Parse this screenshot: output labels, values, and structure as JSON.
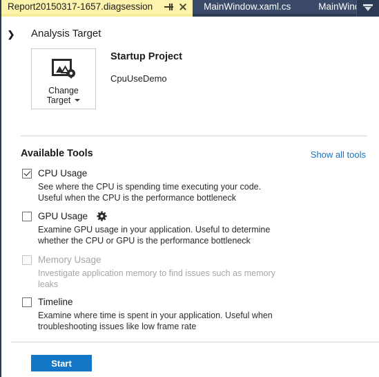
{
  "tabs": {
    "active": {
      "label": "Report20150317-1657.diagsession",
      "pin_icon": "pin-icon",
      "close_icon": "close-icon"
    },
    "inactive": [
      {
        "label": "MainWindow.xaml.cs"
      },
      {
        "label": "MainWindow.xaml"
      }
    ],
    "overflow_icon": "tab-overflow-chevron-icon"
  },
  "analysis": {
    "expander_icon": "chevron-right-icon",
    "section_title": "Analysis Target",
    "change_target": {
      "icon": "image-settings-icon",
      "line1": "Change",
      "line2": "Target",
      "caret_icon": "chevron-down-icon"
    },
    "startup_heading": "Startup Project",
    "startup_value": "CpuUseDemo"
  },
  "tools": {
    "header": "Available Tools",
    "show_all_link": "Show all tools",
    "items": [
      {
        "name": "CPU Usage",
        "checked": true,
        "disabled": false,
        "has_gear": false,
        "description": "See where the CPU is spending time executing your code. Useful when the CPU is the performance bottleneck"
      },
      {
        "name": "GPU Usage",
        "checked": false,
        "disabled": false,
        "has_gear": true,
        "gear_icon": "gear-icon",
        "description": "Examine GPU usage in your application. Useful to determine whether the CPU or GPU is the performance bottleneck"
      },
      {
        "name": "Memory Usage",
        "checked": false,
        "disabled": true,
        "has_gear": false,
        "description": "Investigate application memory to find issues such as memory leaks"
      },
      {
        "name": "Timeline",
        "checked": false,
        "disabled": false,
        "has_gear": false,
        "description": "Examine where time is spent in your application. Useful when troubleshooting issues like low frame rate"
      }
    ]
  },
  "footer": {
    "start_label": "Start"
  },
  "colors": {
    "tabstrip_background": "#2d3a53",
    "active_tab_background": "#fdf3ac",
    "inactive_tab_background": "#3a4a68",
    "accent_blue": "#1476c6",
    "link_blue": "#1570c0",
    "disabled_text": "#a6a6a6"
  }
}
